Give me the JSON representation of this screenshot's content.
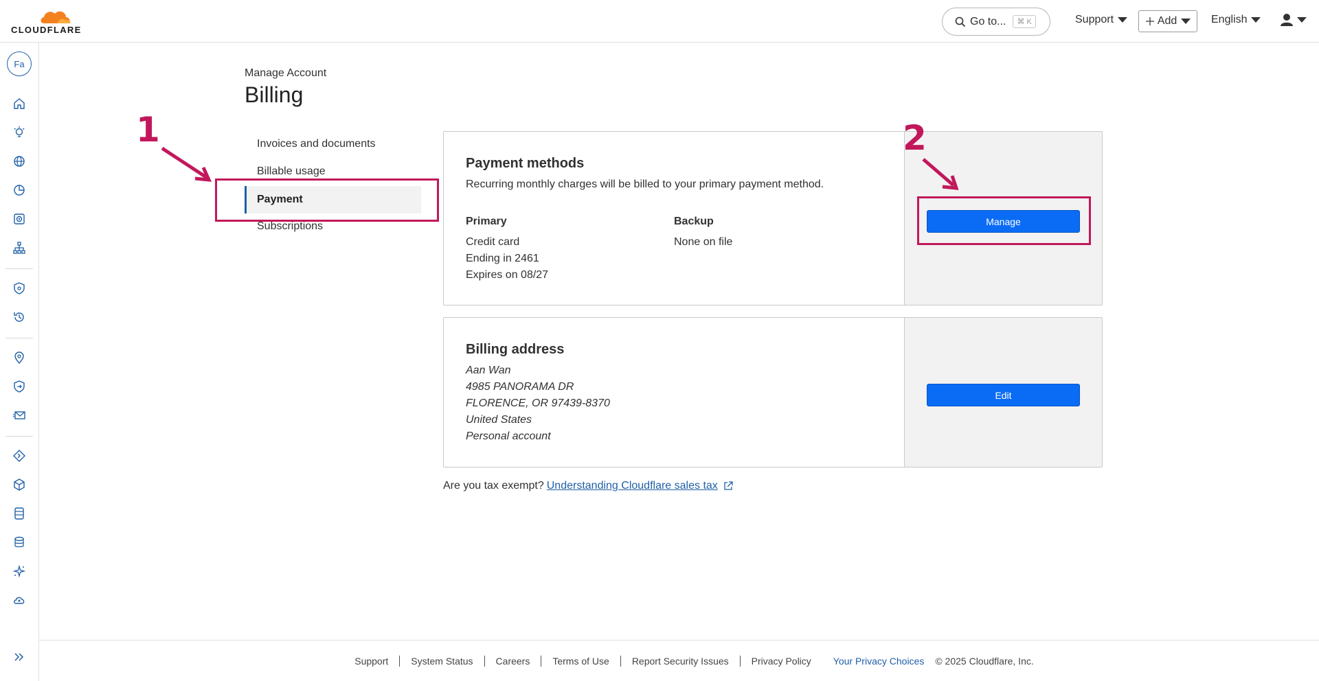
{
  "topbar": {
    "logo_text": "CLOUDFLARE",
    "goto_label": "Go to...",
    "goto_shortcut": "⌘ K",
    "support_label": "Support",
    "add_label": "Add",
    "language_label": "English"
  },
  "rail": {
    "account_initials": "Fa"
  },
  "header": {
    "eyebrow": "Manage Account",
    "title": "Billing"
  },
  "subnav": {
    "items": [
      "Invoices and documents",
      "Billable usage",
      "Payment",
      "Subscriptions"
    ],
    "active": "Payment"
  },
  "payment": {
    "title": "Payment methods",
    "description": "Recurring monthly charges will be billed to your primary payment method.",
    "primary_label": "Primary",
    "primary_type": "Credit card",
    "primary_ending": "Ending in 2461",
    "primary_expires": "Expires on 08/27",
    "backup_label": "Backup",
    "backup_value": "None on file",
    "button": "Manage"
  },
  "address": {
    "title": "Billing address",
    "lines": [
      "Aan Wan",
      "4985 PANORAMA DR",
      "FLORENCE, OR 97439-8370",
      "United States",
      "Personal account"
    ],
    "button": "Edit"
  },
  "tax": {
    "question": "Are you tax exempt?",
    "link": "Understanding Cloudflare sales tax"
  },
  "annotations": {
    "step1": "1",
    "step2": "2"
  },
  "footer": {
    "links": [
      "Support",
      "System Status",
      "Careers",
      "Terms of Use",
      "Report Security Issues",
      "Privacy Policy"
    ],
    "privacy_choices": "Your Privacy Choices",
    "copyright": "© 2025 Cloudflare, Inc."
  },
  "colors": {
    "primary_button": "#0a6cf5",
    "link": "#1f5fa8",
    "annotation": "#c2185b",
    "logo_orange": "#f48120"
  }
}
